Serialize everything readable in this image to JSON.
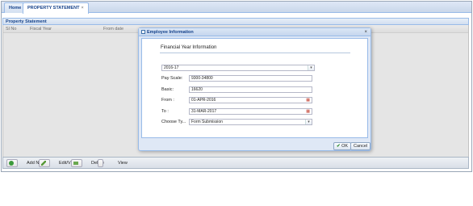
{
  "tabs": [
    {
      "label": "Home"
    },
    {
      "label": "PROPERTY STATEMENT",
      "close": "×"
    }
  ],
  "panel": {
    "title": "Property Statement",
    "columns": [
      "Sl No",
      "Fiscal Year",
      "From date"
    ]
  },
  "toolbar": {
    "add_label": "Add New",
    "edit_label": "Edit/View",
    "delete_label": "Delete",
    "view_label": "View"
  },
  "dialog": {
    "title": "Employee Information",
    "close": "×",
    "section_title": "Financial Year Information",
    "year_value": "2016-17",
    "fields": {
      "pay_scale_label": "Pay Scale:",
      "pay_scale_value": "9300-34800",
      "basic_label": "Basic:",
      "basic_value": "16620",
      "from_label": "From :",
      "from_value": "01-APR-2016",
      "to_label": "To :",
      "to_value": "31-MAR-2017",
      "choose_label": "Choose Ty...",
      "choose_value": "Form Submission"
    },
    "ok_label": "OK",
    "cancel_label": "Cancel"
  },
  "icons": {
    "dropdown": "chevron-down-icon",
    "calendar": "calendar-icon"
  }
}
